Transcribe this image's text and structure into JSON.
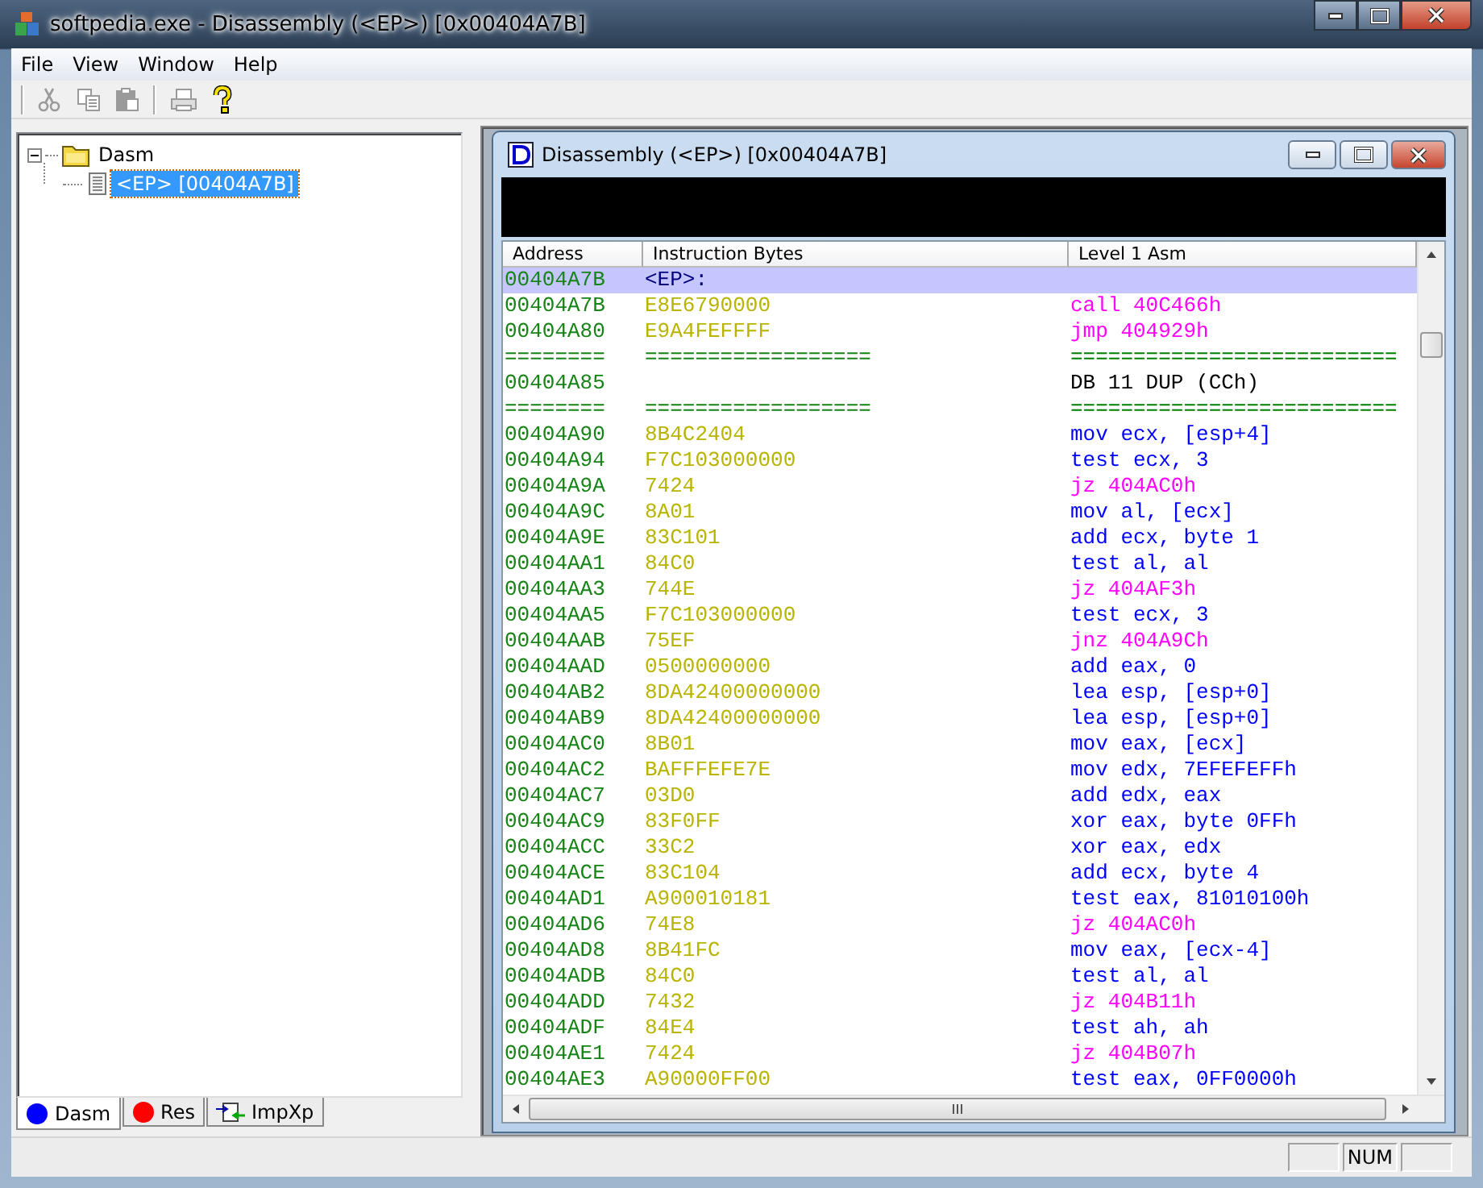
{
  "window": {
    "title": "softpedia.exe - Disassembly (<EP>) [0x00404A7B]"
  },
  "menu": [
    "File",
    "View",
    "Window",
    "Help"
  ],
  "toolbar": [
    {
      "kind": "cut",
      "disabled": true
    },
    {
      "kind": "copy",
      "disabled": true
    },
    {
      "kind": "paste",
      "disabled": true
    },
    {
      "kind": "print",
      "disabled": true
    },
    {
      "kind": "help",
      "disabled": false
    }
  ],
  "tree": {
    "items": [
      {
        "label": "Dasm",
        "expanded": true,
        "selected": false,
        "children": [
          {
            "label": "<EP> [00404A7B]",
            "selected": true
          }
        ]
      }
    ]
  },
  "panel_tabs": [
    {
      "label": "Dasm",
      "kind": "dot",
      "color": "#0000ff",
      "selected": true
    },
    {
      "label": "Res",
      "kind": "dot",
      "color": "#ff0000",
      "selected": false
    },
    {
      "label": "ImpXp",
      "kind": "arrows",
      "selected": false
    }
  ],
  "child_window": {
    "title": "Disassembly (<EP>) [0x00404A7B]",
    "columns": [
      "Address",
      "Instruction Bytes",
      "Level 1 Asm"
    ],
    "rows": [
      {
        "kind": "label",
        "address": "00404A7B",
        "bytes": "<EP>:",
        "selected": true
      },
      {
        "kind": "branch",
        "address": "00404A7B",
        "bytes": "E8E6790000",
        "asm": "call 40C466h",
        "selected": false
      },
      {
        "kind": "branch",
        "address": "00404A80",
        "bytes": "E9A4FEFFFF",
        "asm": "jmp 404929h",
        "selected": false
      },
      {
        "kind": "separator",
        "address": "========",
        "bytes": "==================",
        "asm": "==========================",
        "selected": false
      },
      {
        "kind": "data",
        "address": "00404A85",
        "asm": "DB 11 DUP (CCh)",
        "selected": false
      },
      {
        "kind": "separator",
        "address": "========",
        "bytes": "==================",
        "asm": "==========================",
        "selected": false
      },
      {
        "kind": "op",
        "address": "00404A90",
        "bytes": "8B4C2404",
        "asm": "mov ecx, [esp+4]",
        "selected": false
      },
      {
        "kind": "op",
        "address": "00404A94",
        "bytes": "F7C103000000",
        "asm": "test ecx, 3",
        "selected": false
      },
      {
        "kind": "branch",
        "address": "00404A9A",
        "bytes": "7424",
        "asm": "jz 404AC0h",
        "selected": false
      },
      {
        "kind": "op",
        "address": "00404A9C",
        "bytes": "8A01",
        "asm": "mov al, [ecx]",
        "selected": false
      },
      {
        "kind": "op",
        "address": "00404A9E",
        "bytes": "83C101",
        "asm": "add ecx, byte 1",
        "selected": false
      },
      {
        "kind": "op",
        "address": "00404AA1",
        "bytes": "84C0",
        "asm": "test al, al",
        "selected": false
      },
      {
        "kind": "branch",
        "address": "00404AA3",
        "bytes": "744E",
        "asm": "jz 404AF3h",
        "selected": false
      },
      {
        "kind": "op",
        "address": "00404AA5",
        "bytes": "F7C103000000",
        "asm": "test ecx, 3",
        "selected": false
      },
      {
        "kind": "branch",
        "address": "00404AAB",
        "bytes": "75EF",
        "asm": "jnz 404A9Ch",
        "selected": false
      },
      {
        "kind": "op",
        "address": "00404AAD",
        "bytes": "0500000000",
        "asm": "add eax, 0",
        "selected": false
      },
      {
        "kind": "op",
        "address": "00404AB2",
        "bytes": "8DA42400000000",
        "asm": "lea esp, [esp+0]",
        "selected": false
      },
      {
        "kind": "op",
        "address": "00404AB9",
        "bytes": "8DA42400000000",
        "asm": "lea esp, [esp+0]",
        "selected": false
      },
      {
        "kind": "op",
        "address": "00404AC0",
        "bytes": "8B01",
        "asm": "mov eax, [ecx]",
        "selected": false
      },
      {
        "kind": "op",
        "address": "00404AC2",
        "bytes": "BAFFFEFE7E",
        "asm": "mov edx, 7EFEFEFFh",
        "selected": false
      },
      {
        "kind": "op",
        "address": "00404AC7",
        "bytes": "03D0",
        "asm": "add edx, eax",
        "selected": false
      },
      {
        "kind": "op",
        "address": "00404AC9",
        "bytes": "83F0FF",
        "asm": "xor eax, byte 0FFh",
        "selected": false
      },
      {
        "kind": "op",
        "address": "00404ACC",
        "bytes": "33C2",
        "asm": "xor eax, edx",
        "selected": false
      },
      {
        "kind": "op",
        "address": "00404ACE",
        "bytes": "83C104",
        "asm": "add ecx, byte 4",
        "selected": false
      },
      {
        "kind": "op",
        "address": "00404AD1",
        "bytes": "A900010181",
        "asm": "test eax, 81010100h",
        "selected": false
      },
      {
        "kind": "branch",
        "address": "00404AD6",
        "bytes": "74E8",
        "asm": "jz 404AC0h",
        "selected": false
      },
      {
        "kind": "op",
        "address": "00404AD8",
        "bytes": "8B41FC",
        "asm": "mov eax, [ecx-4]",
        "selected": false
      },
      {
        "kind": "op",
        "address": "00404ADB",
        "bytes": "84C0",
        "asm": "test al, al",
        "selected": false
      },
      {
        "kind": "branch",
        "address": "00404ADD",
        "bytes": "7432",
        "asm": "jz 404B11h",
        "selected": false
      },
      {
        "kind": "op",
        "address": "00404ADF",
        "bytes": "84E4",
        "asm": "test ah, ah",
        "selected": false
      },
      {
        "kind": "branch",
        "address": "00404AE1",
        "bytes": "7424",
        "asm": "jz 404B07h",
        "selected": false
      },
      {
        "kind": "op",
        "address": "00404AE3",
        "bytes": "A90000FF00",
        "asm": "test eax, 0FF0000h",
        "selected": false
      }
    ]
  },
  "status_bar": {
    "num_lock": "NUM"
  }
}
